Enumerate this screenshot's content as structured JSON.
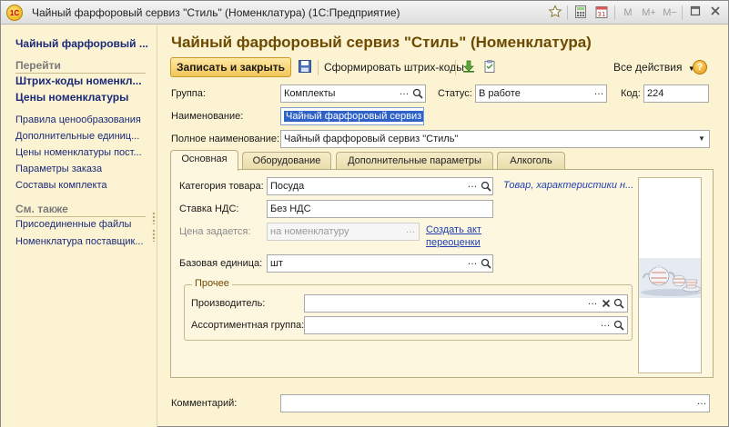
{
  "window": {
    "title": "Чайный фарфоровый сервиз \"Стиль\" (Номенклатура)  (1С:Предприятие)",
    "logo_text": "1С",
    "buttons": {
      "m": "M",
      "m_plus": "M+",
      "m_minus": "M−"
    }
  },
  "left_panel": {
    "title": "Чайный фарфоровый ...",
    "section_go": "Перейти",
    "go_links": [
      "Штрих-коды номенкл...",
      "Цены номенклатуры"
    ],
    "links": [
      "Правила ценообразования",
      "Дополнительные единиц...",
      "Цены номенклатуры пост...",
      "Параметры заказа",
      "Составы комплекта"
    ],
    "section_see_also": "См. также",
    "see_also_links": [
      "Присоединенные файлы",
      "Номенклатура поставщик..."
    ]
  },
  "form": {
    "title": "Чайный фарфоровый сервиз \"Стиль\" (Номенклатура)",
    "toolbar": {
      "save_close": "Записать и закрыть",
      "barcodes": "Сформировать штрих-коды",
      "all_actions": "Все действия",
      "help": "?"
    },
    "group_label": "Группа:",
    "group_value": "Комплекты",
    "status_label": "Статус:",
    "status_value": "В работе",
    "code_label": "Код:",
    "code_value": "224",
    "name_label": "Наименование:",
    "name_value": "Чайный фарфоровый сервиз",
    "full_name_label": "Полное наименование:",
    "full_name_value": "Чайный фарфоровый сервиз \"Стиль\"",
    "tabs": [
      "Основная",
      "Оборудование",
      "Дополнительные параметры",
      "Алкоголь"
    ],
    "main_tab": {
      "category_label": "Категория товара:",
      "category_value": "Посуда",
      "category_link": "Товар, характеристики н...",
      "vat_label": "Ставка НДС:",
      "vat_value": "Без НДС",
      "price_label": "Цена задается:",
      "price_value": "на номенклатуру",
      "revaluation_link": [
        "Создать акт",
        "переоценки"
      ],
      "unit_label": "Базовая единица:",
      "unit_value": "шт",
      "other_group": "Прочее",
      "manufacturer_label": "Производитель:",
      "manufacturer_value": "",
      "assortment_label": "Ассортиментная группа:",
      "assortment_value": ""
    },
    "comment_label": "Комментарий:",
    "comment_value": ""
  },
  "colors": {
    "background": "#fcf3d3",
    "title_brown": "#6d4a00",
    "link_blue": "#1b2a78",
    "primary_button": "#f2c659"
  }
}
